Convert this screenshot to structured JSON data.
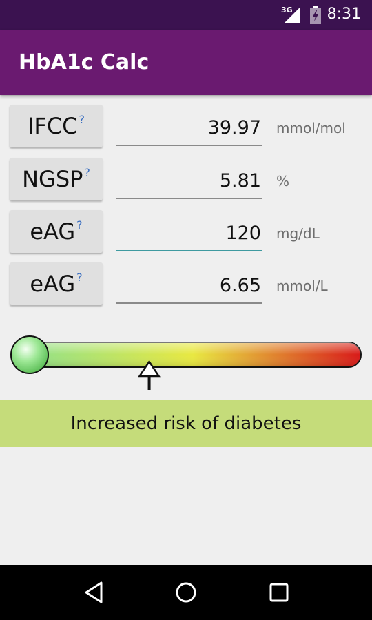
{
  "status_bar": {
    "network": "3G",
    "time": "8:31",
    "icons": [
      "signal-icon",
      "battery-charging-icon"
    ]
  },
  "app_bar": {
    "title": "HbA1c Calc"
  },
  "rows": [
    {
      "label": "IFCC",
      "help": "?",
      "value": "39.97",
      "unit": "mmol/mol"
    },
    {
      "label": "NGSP",
      "help": "?",
      "value": "5.81",
      "unit": "%"
    },
    {
      "label": "eAG",
      "help": "?",
      "value": "120",
      "unit": "mg/dL"
    },
    {
      "label": "eAG",
      "help": "?",
      "value": "6.65",
      "unit": "mmol/L"
    }
  ],
  "risk_scale": {
    "indicator_fraction": 0.37,
    "gradient_colors": [
      "#8fe08a",
      "#e8e840",
      "#d81818"
    ]
  },
  "risk_message": {
    "text": "Increased risk of diabetes",
    "background_color": "#c5dc7a"
  },
  "nav_bar": {
    "icons": [
      "back-icon",
      "home-icon",
      "recents-icon"
    ]
  }
}
